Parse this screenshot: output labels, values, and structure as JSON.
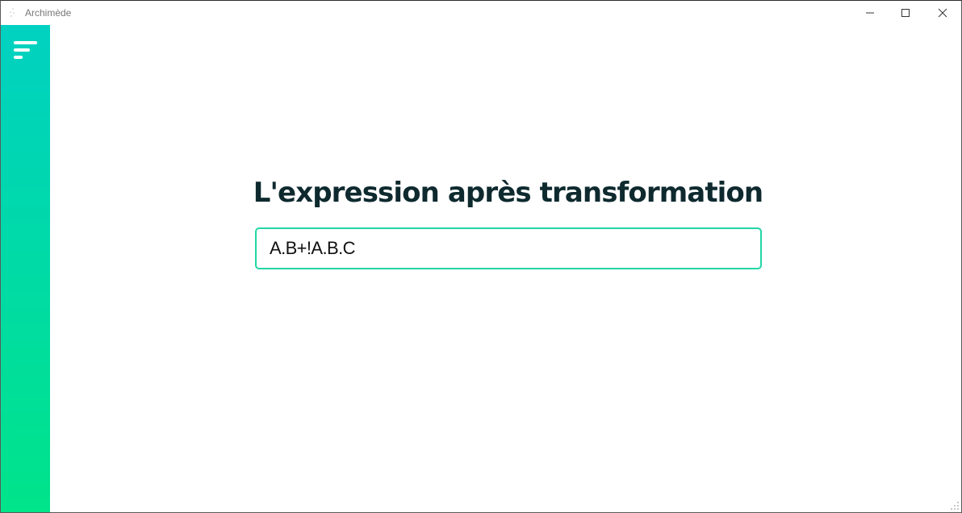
{
  "window": {
    "title": "Archimède",
    "icons": {
      "app": "app-icon",
      "minimize": "minimize-icon",
      "maximize": "maximize-icon",
      "close": "close-icon",
      "resize": "resize-grip-icon"
    }
  },
  "sidebar": {
    "menu_icon": "hamburger-menu-icon",
    "gradient": [
      "#00d1c1",
      "#00e48a"
    ]
  },
  "main": {
    "heading": "L'expression après transformation",
    "expression": "A.B+!A.B.C"
  },
  "colors": {
    "accent": "#22d6a6",
    "heading": "#0e2a2f"
  }
}
